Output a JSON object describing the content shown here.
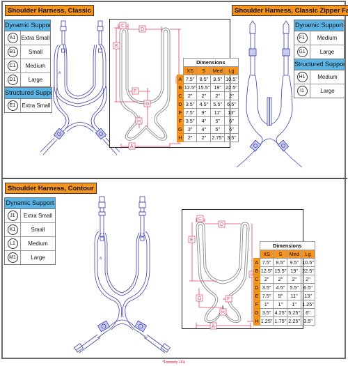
{
  "sections": {
    "classic": {
      "title": "Shoulder Harness, Classic",
      "dynamic": {
        "heading": "Dynamic Support",
        "items": [
          {
            "code": "A1",
            "size": "Extra Small"
          },
          {
            "code": "B1",
            "size": "Small"
          },
          {
            "code": "C1",
            "size": "Medium"
          },
          {
            "code": "D1",
            "size": "Large"
          }
        ]
      },
      "structured": {
        "heading": "Structured Support",
        "items": [
          {
            "code": "E1",
            "size": "Extra Small"
          }
        ]
      },
      "dimensions": {
        "caption": "Dimensions",
        "columns": [
          "XS",
          "S",
          "Med",
          "Lg"
        ],
        "rows": [
          {
            "label": "A",
            "values": [
              "7.5\"",
              "8.5\"",
              "9.5\"",
              "10.5\""
            ]
          },
          {
            "label": "B",
            "values": [
              "12.5\"",
              "15.5\"",
              "19\"",
              "22.5\""
            ]
          },
          {
            "label": "C",
            "values": [
              "2\"",
              "2\"",
              "2\"",
              "2\""
            ]
          },
          {
            "label": "D",
            "values": [
              "3.5\"",
              "4.5\"",
              "5.5\"",
              "6.5\""
            ]
          },
          {
            "label": "E",
            "values": [
              "7.5\"",
              "9\"",
              "11\"",
              "13\""
            ]
          },
          {
            "label": "F",
            "values": [
              "3.5\"",
              "4\"",
              "5\"",
              "6\""
            ]
          },
          {
            "label": "G",
            "values": [
              "3\"",
              "4\"",
              "5\"",
              "6\""
            ]
          },
          {
            "label": "H",
            "values": [
              "2\"",
              "2\"",
              "2.75\"",
              "3.5\""
            ]
          }
        ]
      },
      "diagram_labels": [
        "A",
        "B",
        "C",
        "D",
        "E",
        "F",
        "G",
        "H"
      ]
    },
    "zipper": {
      "title": "Shoulder Harness,  Classic Zipper Face",
      "dynamic": {
        "heading": "Dynamic Support",
        "items": [
          {
            "code": "F1",
            "size": "Medium"
          },
          {
            "code": "G1",
            "size": "Large"
          }
        ]
      },
      "structured": {
        "heading": "Structured Support",
        "items": [
          {
            "code": "H1",
            "size": "Medium"
          },
          {
            "code": "I1",
            "size": "Large"
          }
        ]
      }
    },
    "contour": {
      "title": "Shoulder Harness, Contour",
      "dynamic": {
        "heading": "Dynamic Support",
        "items": [
          {
            "code": "J1",
            "size": "Extra Small"
          },
          {
            "code": "K1",
            "size": "Small"
          },
          {
            "code": "L1",
            "size": "Medium"
          },
          {
            "code": "M1",
            "size": "Large"
          }
        ]
      },
      "dimensions": {
        "caption": "Dimensions",
        "columns": [
          "XS",
          "S",
          "Med",
          "Lg"
        ],
        "rows": [
          {
            "label": "A",
            "values": [
              "7.5\"",
              "8.5\"",
              "9.5\"",
              "10.5\""
            ]
          },
          {
            "label": "B",
            "values": [
              "12.5\"",
              "15.5\"",
              "19\"",
              "22.5\""
            ]
          },
          {
            "label": "C",
            "values": [
              "2\"",
              "2\"",
              "2\"",
              "2\""
            ]
          },
          {
            "label": "D",
            "values": [
              "3.5\"",
              "4.5\"",
              "5.5\"",
              "6.5\""
            ]
          },
          {
            "label": "E",
            "values": [
              "7.5\"",
              "9\"",
              "11\"",
              "13\""
            ]
          },
          {
            "label": "F",
            "values": [
              "1\"",
              "1\"",
              "1\"",
              "1.25\""
            ]
          },
          {
            "label": "G",
            "values": [
              "3.5\"",
              "4.25\"",
              "5.25\"",
              "6\""
            ]
          },
          {
            "label": "H",
            "values": [
              "1.25\"",
              "1.75\"",
              "2.25\"",
              "3.5\""
            ]
          }
        ]
      },
      "diagram_labels": [
        "A",
        "B",
        "C",
        "D",
        "E",
        "F",
        "G",
        "H"
      ]
    }
  },
  "footnote": "*Formerly i-Fit.",
  "colors": {
    "title_bg": "#f7941d",
    "support_header_bg": "#5ab4e5",
    "harness_line": "#3b3fa8",
    "dimension_line": "#d9455f"
  }
}
